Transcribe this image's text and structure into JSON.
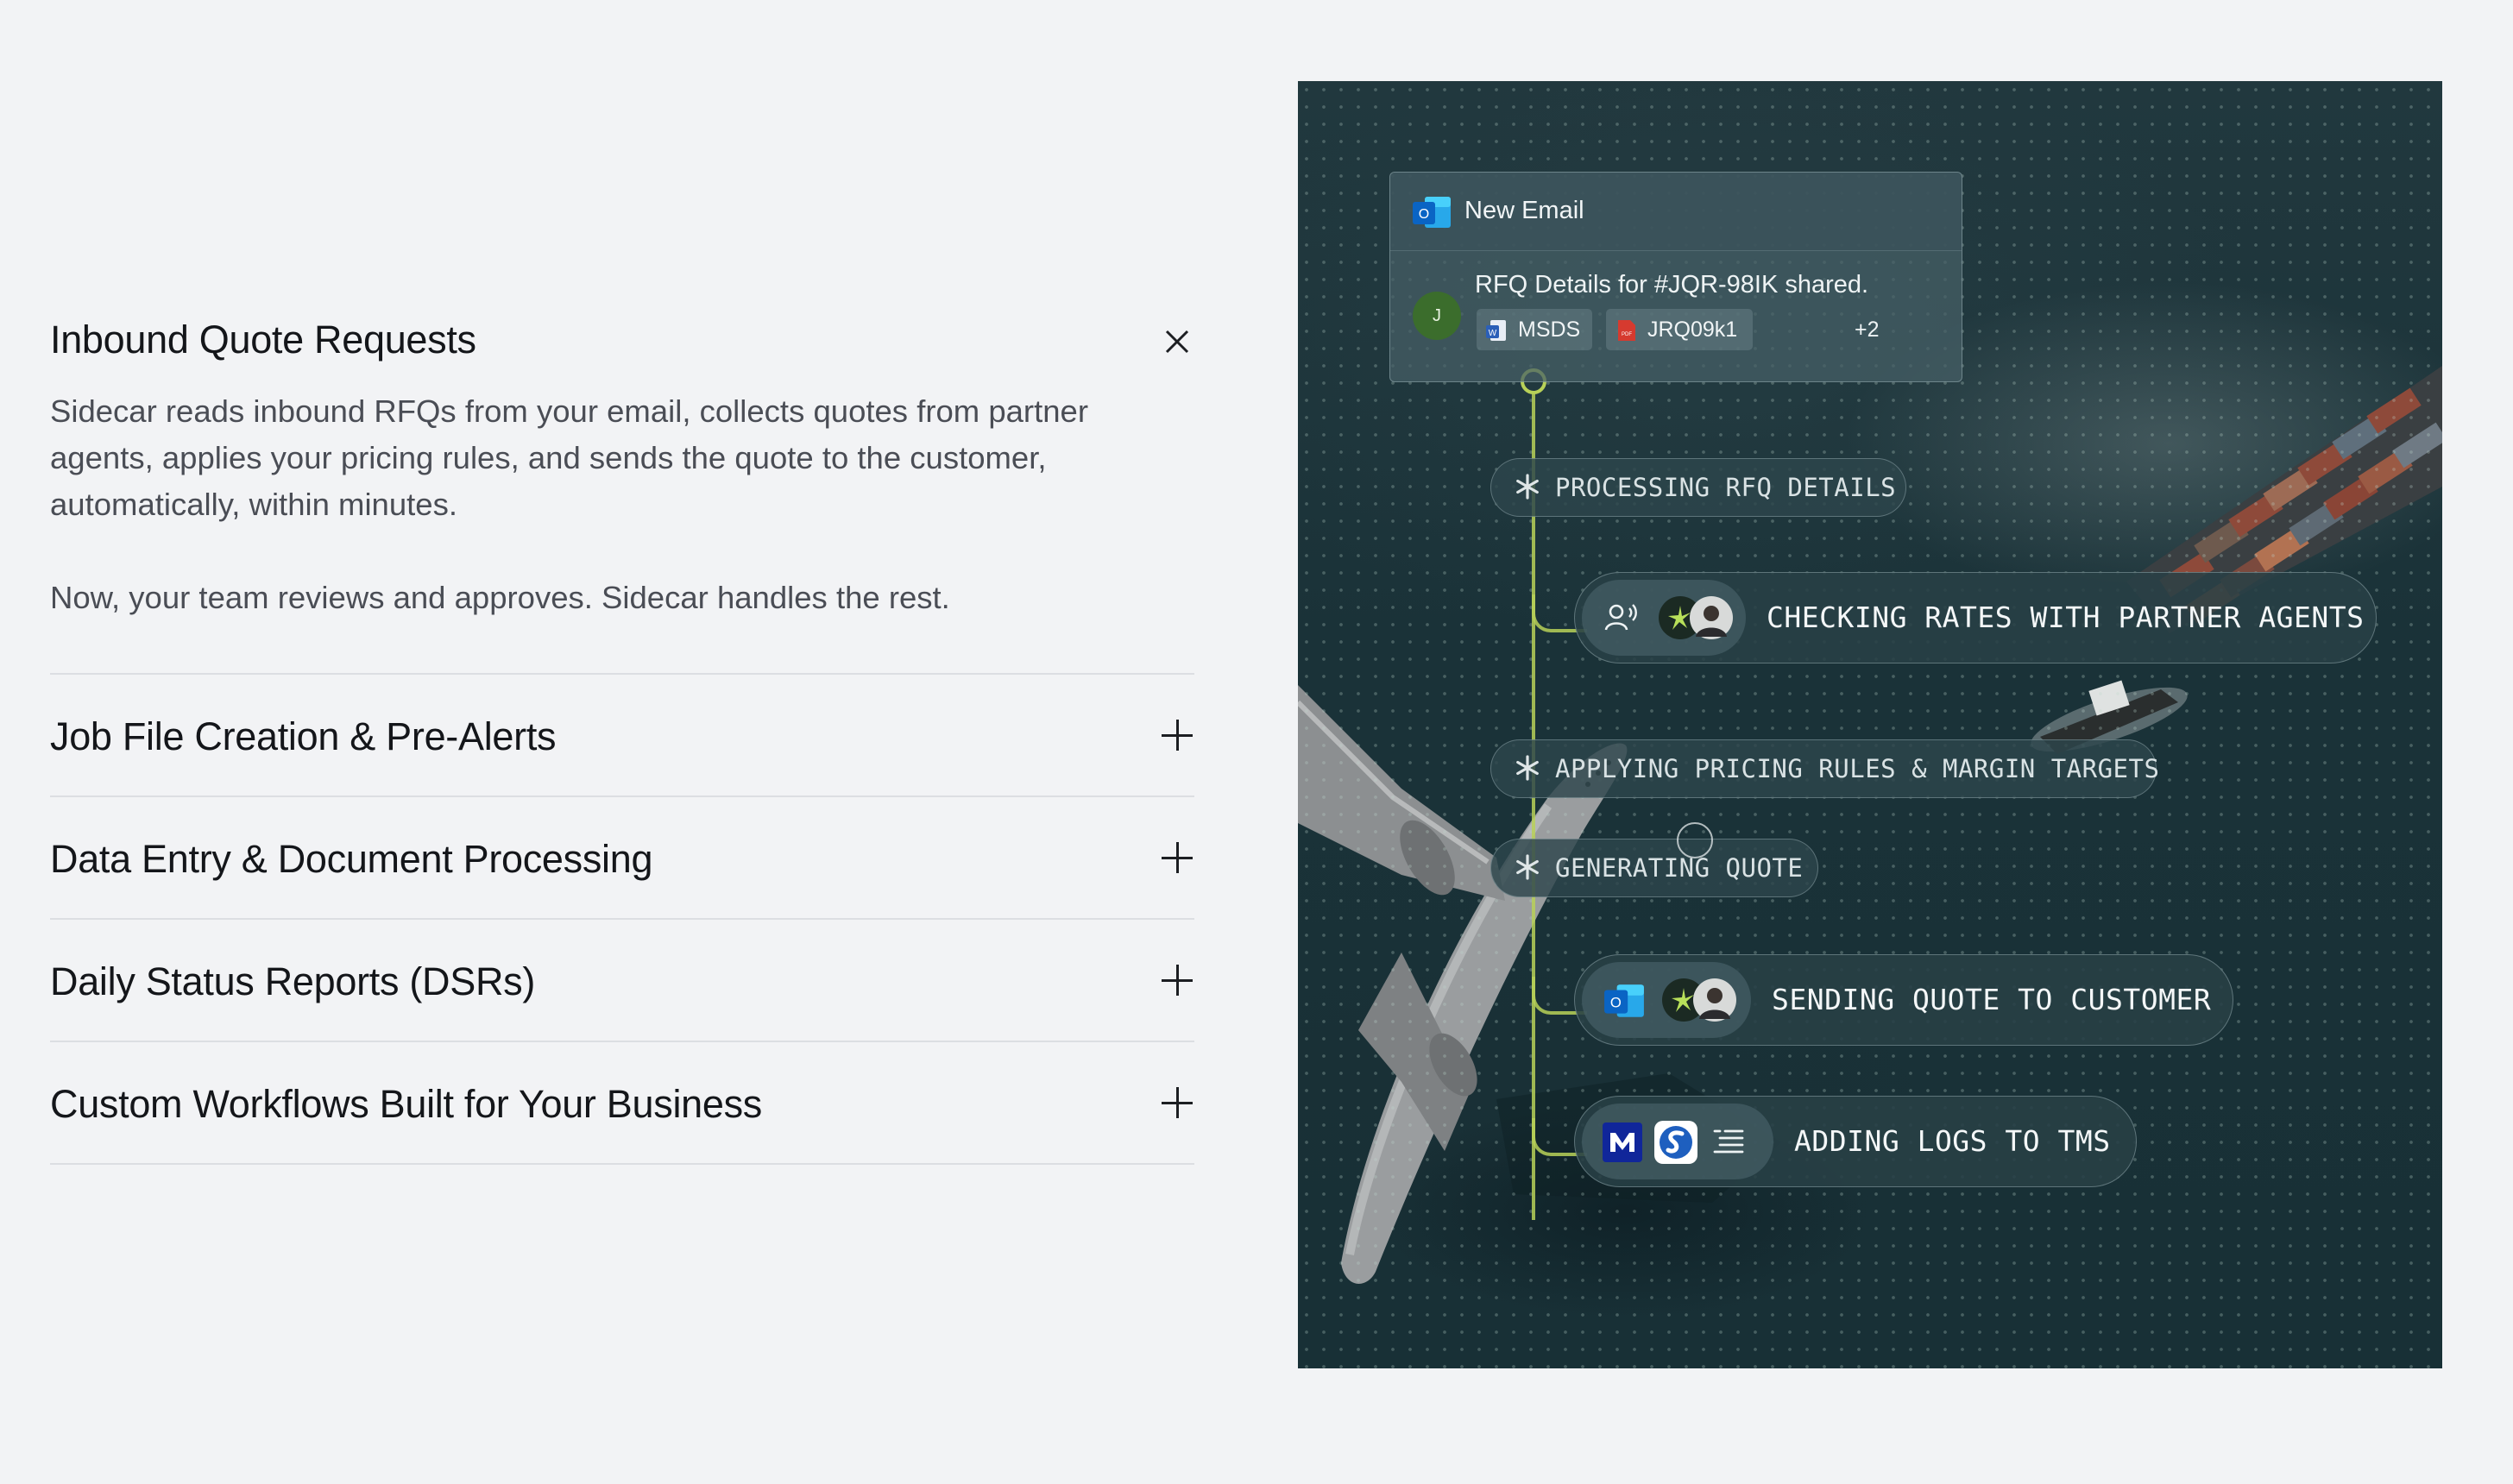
{
  "accordion": {
    "open_item": {
      "title": "Inbound Quote Requests",
      "paragraph_1": "Sidecar reads inbound RFQs from your email, collects quotes from partner agents, applies your pricing rules, and sends the quote to the customer, automatically, within minutes.",
      "paragraph_2": "Now, your team reviews and approves. Sidecar handles the rest."
    },
    "items": [
      {
        "title": "Job File Creation & Pre-Alerts"
      },
      {
        "title": "Data Entry & Document Processing"
      },
      {
        "title": "Daily Status Reports (DSRs)"
      },
      {
        "title": "Custom Workflows Built for Your Business"
      }
    ]
  },
  "hero": {
    "email": {
      "header": "New Email",
      "avatar_initial": "J",
      "subject": "RFQ Details for #JQR-98IK shared.",
      "attachments": [
        {
          "name": "MSDS",
          "icon": "word-doc-icon"
        },
        {
          "name": "JRQ09k1",
          "icon": "pdf-icon"
        }
      ],
      "more_count": "+2"
    },
    "steps": [
      {
        "label": "PROCESSING RFQ DETAILS",
        "style": "small"
      },
      {
        "label": "CHECKING RATES WITH PARTNER AGENTS",
        "style": "large"
      },
      {
        "label": "APPLYING PRICING RULES & MARGIN TARGETS",
        "style": "small"
      },
      {
        "label": "GENERATING QUOTE",
        "style": "small"
      },
      {
        "label": "SENDING QUOTE TO CUSTOMER",
        "style": "large"
      },
      {
        "label": "ADDING LOGS TO TMS",
        "style": "large"
      }
    ],
    "colors": {
      "timeline": "#b8d158",
      "outlook_blue": "#1f6fd1",
      "sidecar_green": "#b8e05a",
      "tms_navy": "#10269a"
    }
  }
}
